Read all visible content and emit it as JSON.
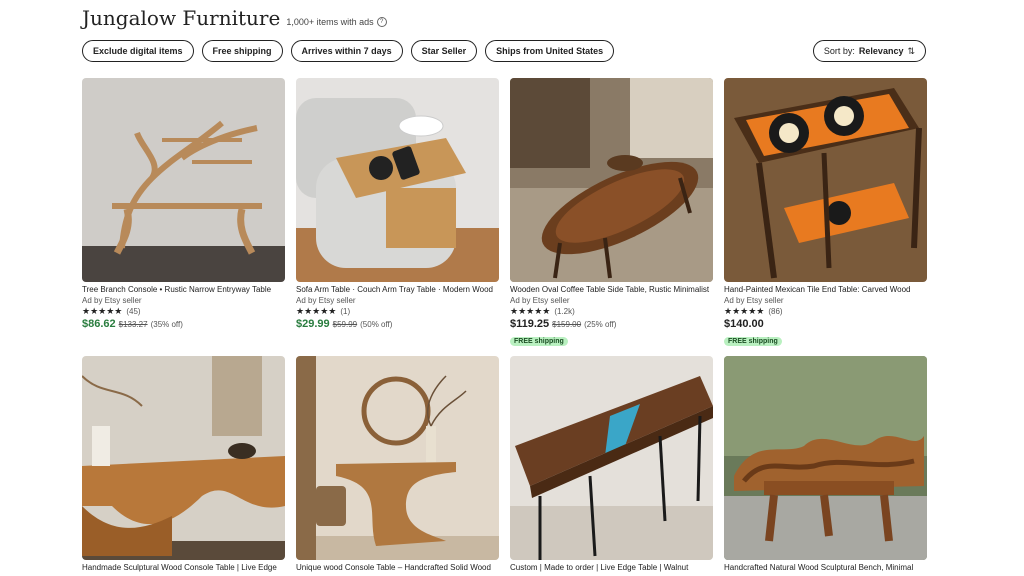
{
  "header": {
    "title": "Jungalow Furniture",
    "count": "1,000+ items with ads"
  },
  "filters": [
    "Exclude digital items",
    "Free shipping",
    "Arrives within 7 days",
    "Star Seller",
    "Ships from United States"
  ],
  "sort": {
    "label": "Sort by:",
    "value": "Relevancy"
  },
  "products": [
    {
      "title": "Tree Branch Console • Rustic Narrow Entryway Table",
      "ad": "Ad by Etsy seller",
      "reviews": "(45)",
      "price": "$86.62",
      "orig": "$133.27",
      "off": "(35% off)",
      "free": ""
    },
    {
      "title": "Sofa Arm Table · Couch Arm Tray Table · Modern Wood",
      "ad": "Ad by Etsy seller",
      "reviews": "(1)",
      "price": "$29.99",
      "orig": "$59.99",
      "off": "(50% off)",
      "free": ""
    },
    {
      "title": "Wooden Oval Coffee Table Side Table, Rustic Minimalist",
      "ad": "Ad by Etsy seller",
      "reviews": "(1.2k)",
      "price": "$119.25",
      "orig": "$159.00",
      "off": "(25% off)",
      "free": "FREE shipping"
    },
    {
      "title": "Hand-Painted Mexican Tile End Table: Carved Wood",
      "ad": "Ad by Etsy seller",
      "reviews": "(86)",
      "price": "$140.00",
      "orig": "",
      "off": "",
      "free": "FREE shipping"
    },
    {
      "title": "Handmade Sculptural Wood Console Table | Live Edge"
    },
    {
      "title": "Unique wood Console Table – Handcrafted Solid Wood"
    },
    {
      "title": "Custom | Made to order | Live Edge Table | Walnut"
    },
    {
      "title": "Handcrafted Natural Wood Sculptural Bench, Minimal"
    }
  ]
}
